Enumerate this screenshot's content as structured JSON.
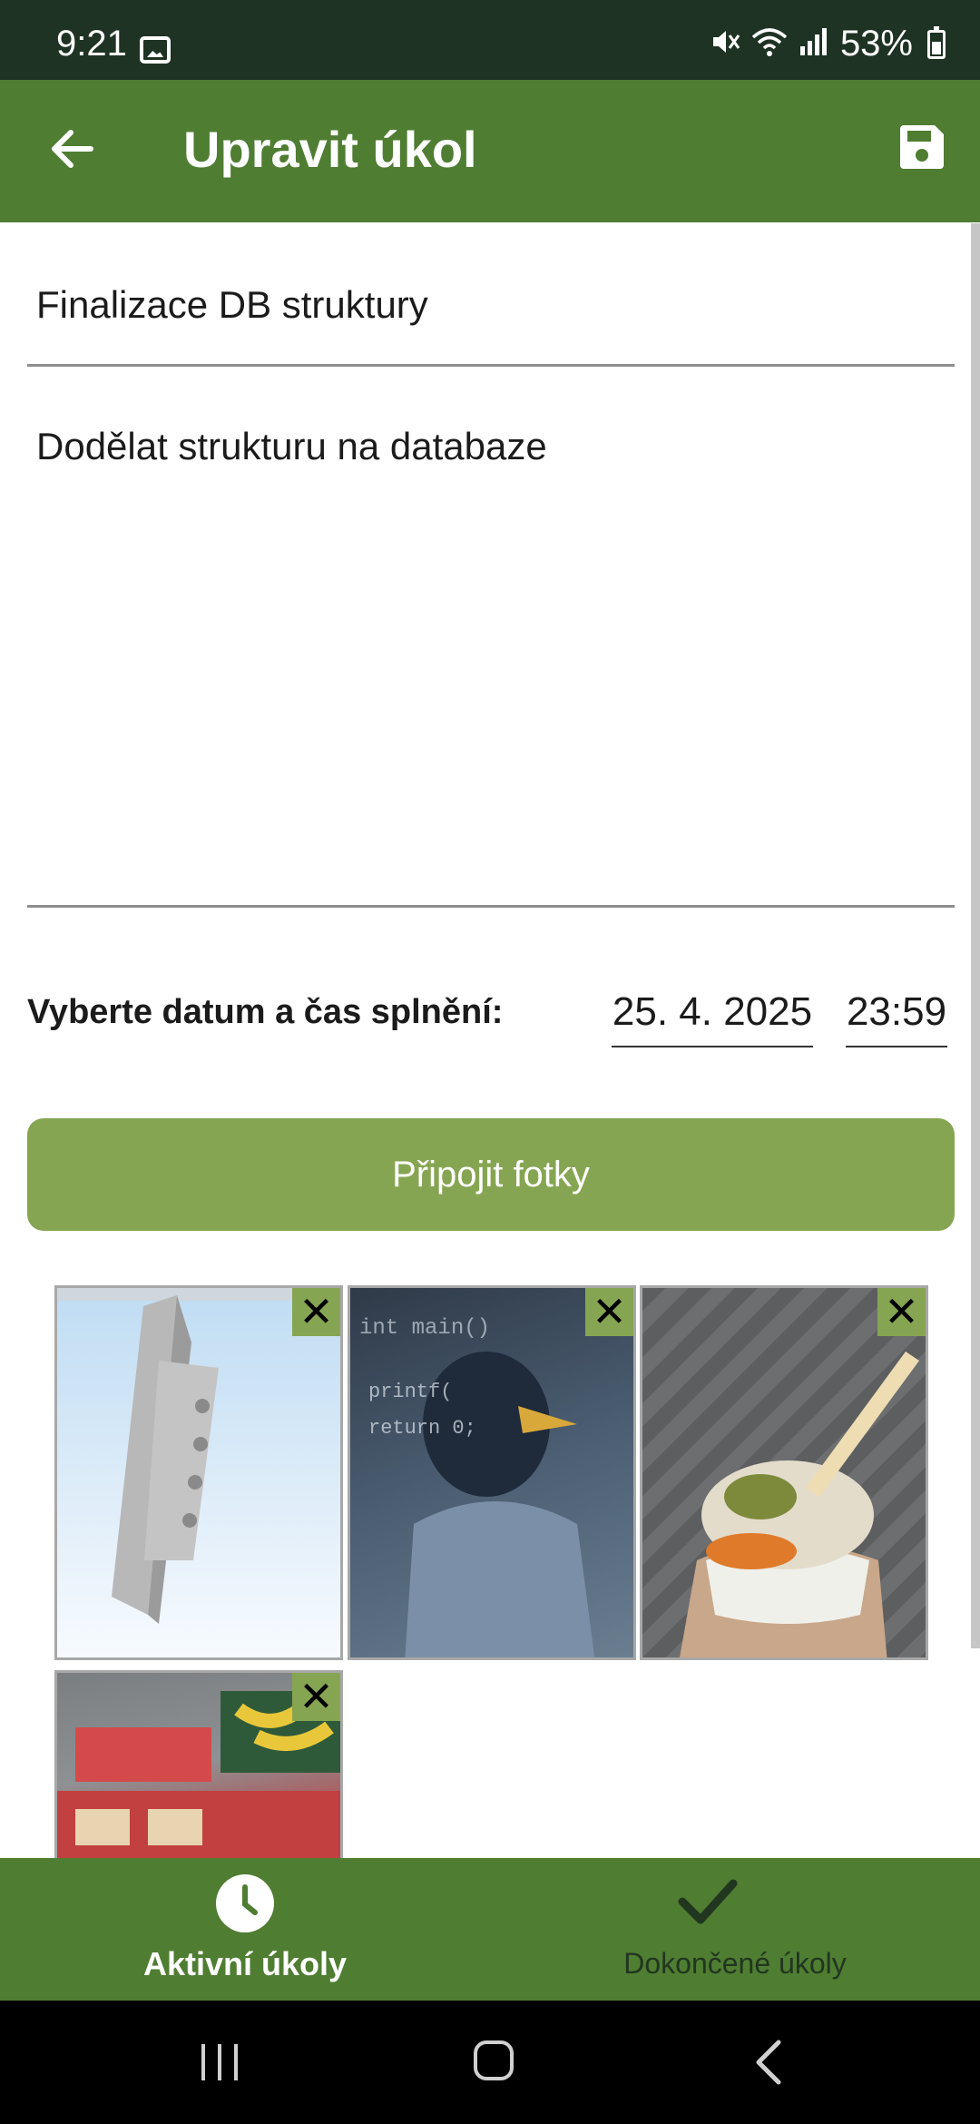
{
  "status_bar": {
    "time": "9:21",
    "battery": "53%",
    "battery_level": 0.53,
    "icons": [
      "gallery-icon",
      "mute-icon",
      "wifi-icon",
      "signal-icon",
      "battery-icon"
    ]
  },
  "app_bar": {
    "title": "Upravit úkol",
    "back_icon": "arrow-left-icon",
    "save_icon": "floppy-disk-icon"
  },
  "form": {
    "title_value": "Finalizace DB struktury",
    "description_value": "Dodělat strukturu na databaze",
    "date_label": "Vyberte datum a čas splnění:",
    "date_value": "25. 4. 2025",
    "time_value": "23:59",
    "attach_button_label": "Připojit fotky"
  },
  "photos": [
    {
      "description": "3D model of metal bracket",
      "remove_icon": "close-icon"
    },
    {
      "description": "starling bird in shirt in front of code board",
      "remove_icon": "close-icon"
    },
    {
      "description": "ice cream cup held over paving",
      "remove_icon": "close-icon"
    },
    {
      "description": "supermarket shelf with bananas and drinks",
      "remove_icon": "close-icon"
    }
  ],
  "photo_remove_symbol": "✕",
  "bottom_nav": {
    "items": [
      {
        "label": "Aktivní úkoly",
        "icon": "clock-icon",
        "active": true
      },
      {
        "label": "Dokončené úkoly",
        "icon": "check-icon",
        "active": false
      }
    ]
  },
  "colors": {
    "status_bar": "#1f3325",
    "app_bar": "#4f7d32",
    "accent_button": "#86a552",
    "nav_inactive_text": "#21361f"
  }
}
